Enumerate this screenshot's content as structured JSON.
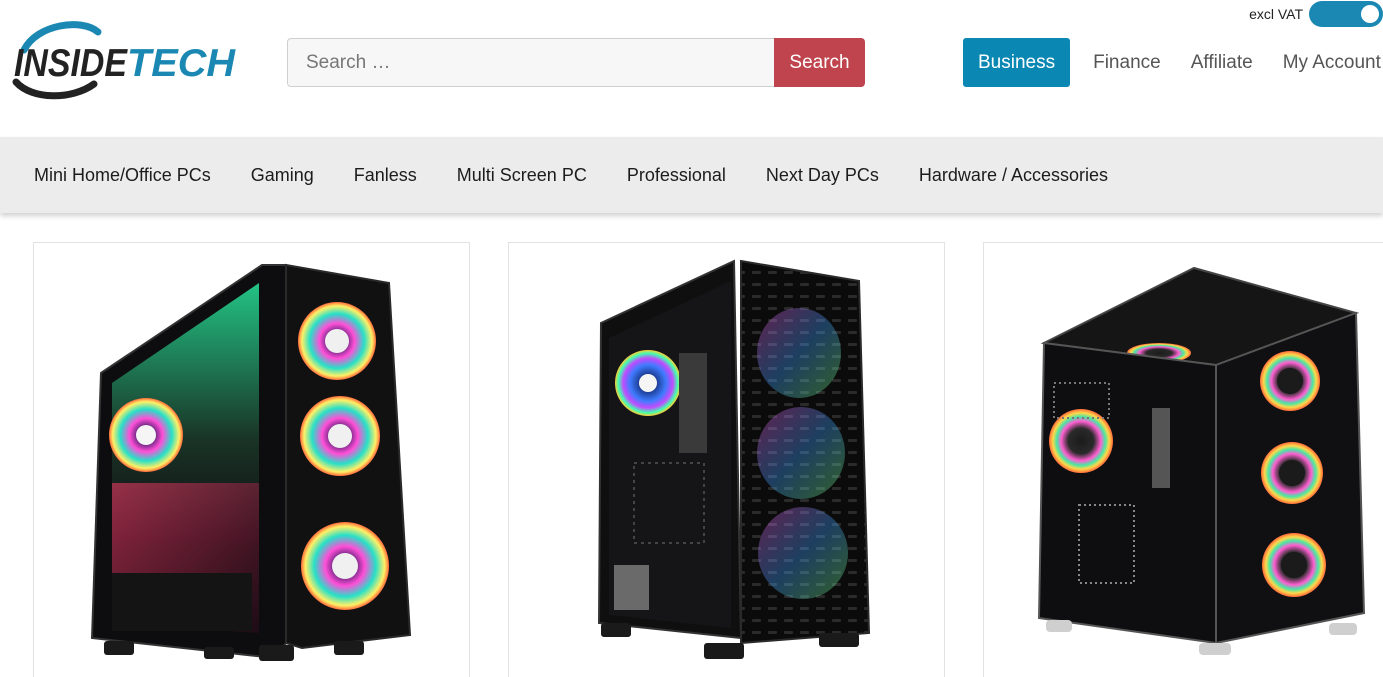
{
  "vat": {
    "label": "excl VAT",
    "on": true
  },
  "logo": {
    "text": "INSIDETECH"
  },
  "search": {
    "placeholder": "Search …",
    "button_label": "Search"
  },
  "top_nav": {
    "business_label": "Business",
    "links": [
      "Finance",
      "Affiliate",
      "My Account"
    ]
  },
  "categories": [
    "Mini Home/Office PCs",
    "Gaming",
    "Fanless",
    "Multi Screen PC",
    "Professional",
    "Next Day PCs",
    "Hardware / Accessories"
  ],
  "colors": {
    "accent": "#0b87b4",
    "search_button": "#c0444e",
    "toggle": "#1a88b3",
    "category_bar": "#ececec"
  },
  "products": [
    {
      "image": "rgb-gaming-case-three-front-fans-icon"
    },
    {
      "image": "mesh-front-gaming-case-icon"
    },
    {
      "image": "glass-cube-gaming-case-icon"
    }
  ]
}
